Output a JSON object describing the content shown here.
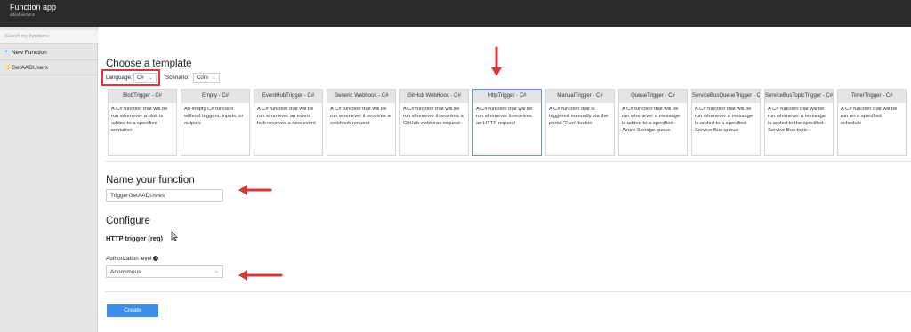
{
  "app": {
    "title": "Function app",
    "subtitle": "adonfunctions"
  },
  "sidebar": {
    "search_placeholder": "Search my functions",
    "items": [
      {
        "icon": "plus-icon",
        "label": "New Function"
      },
      {
        "icon": "function-icon",
        "label": "GetAADUsers"
      }
    ]
  },
  "template": {
    "heading": "Choose a template",
    "language_label": "Language:",
    "language_value": "C#",
    "scenario_label": "Scenario:",
    "scenario_value": "Core",
    "cards": [
      {
        "title": "BlobTrigger - C#",
        "desc": "A C# function that will be run whenever a blob is added to a specified container"
      },
      {
        "title": "Empty - C#",
        "desc": "An empty C# function without triggers, inputs, or outputs"
      },
      {
        "title": "EventHubTrigger - C#",
        "desc": "A C# function that will be run whenever an event hub receives a new event"
      },
      {
        "title": "Generic Webhook - C#",
        "desc": "A C# function that will be run whenever it receives a webhook request"
      },
      {
        "title": "GitHub WebHook - C#",
        "desc": "A C# function that will be run whenever it receives a GitHub webhook request"
      },
      {
        "title": "HttpTrigger - C#",
        "desc": "A C# function that will be run whenever it receives an HTTP request",
        "selected": true
      },
      {
        "title": "ManualTrigger - C#",
        "desc": "A C# function that is triggered manually via the portal \"Run\" button"
      },
      {
        "title": "QueueTrigger - C#",
        "desc": "A C# function that will be run whenever a message is added to a specified Azure Storage queue"
      },
      {
        "title": "ServiceBusQueueTrigger - C#",
        "desc": "A C# function that will be run whenever a message is added to a specified Service Bus queue"
      },
      {
        "title": "ServiceBusTopicTrigger - C#",
        "desc": "A C# function that will be run whenever a message is added to the specified Service Bus topic"
      },
      {
        "title": "TimerTrigger - C#",
        "desc": "A C# function that will be run on a specified schedule"
      }
    ]
  },
  "name_section": {
    "heading": "Name your function",
    "value": "TriggerGetAADUsres"
  },
  "configure": {
    "heading": "Configure",
    "trigger_label": "HTTP trigger (req)",
    "auth_label": "Authorization level",
    "auth_value": "Anonymous"
  },
  "create_label": "Create",
  "colors": {
    "topbar": "#2b2b2b",
    "accent": "#3c8ee6",
    "annotation": "#d9383a"
  }
}
